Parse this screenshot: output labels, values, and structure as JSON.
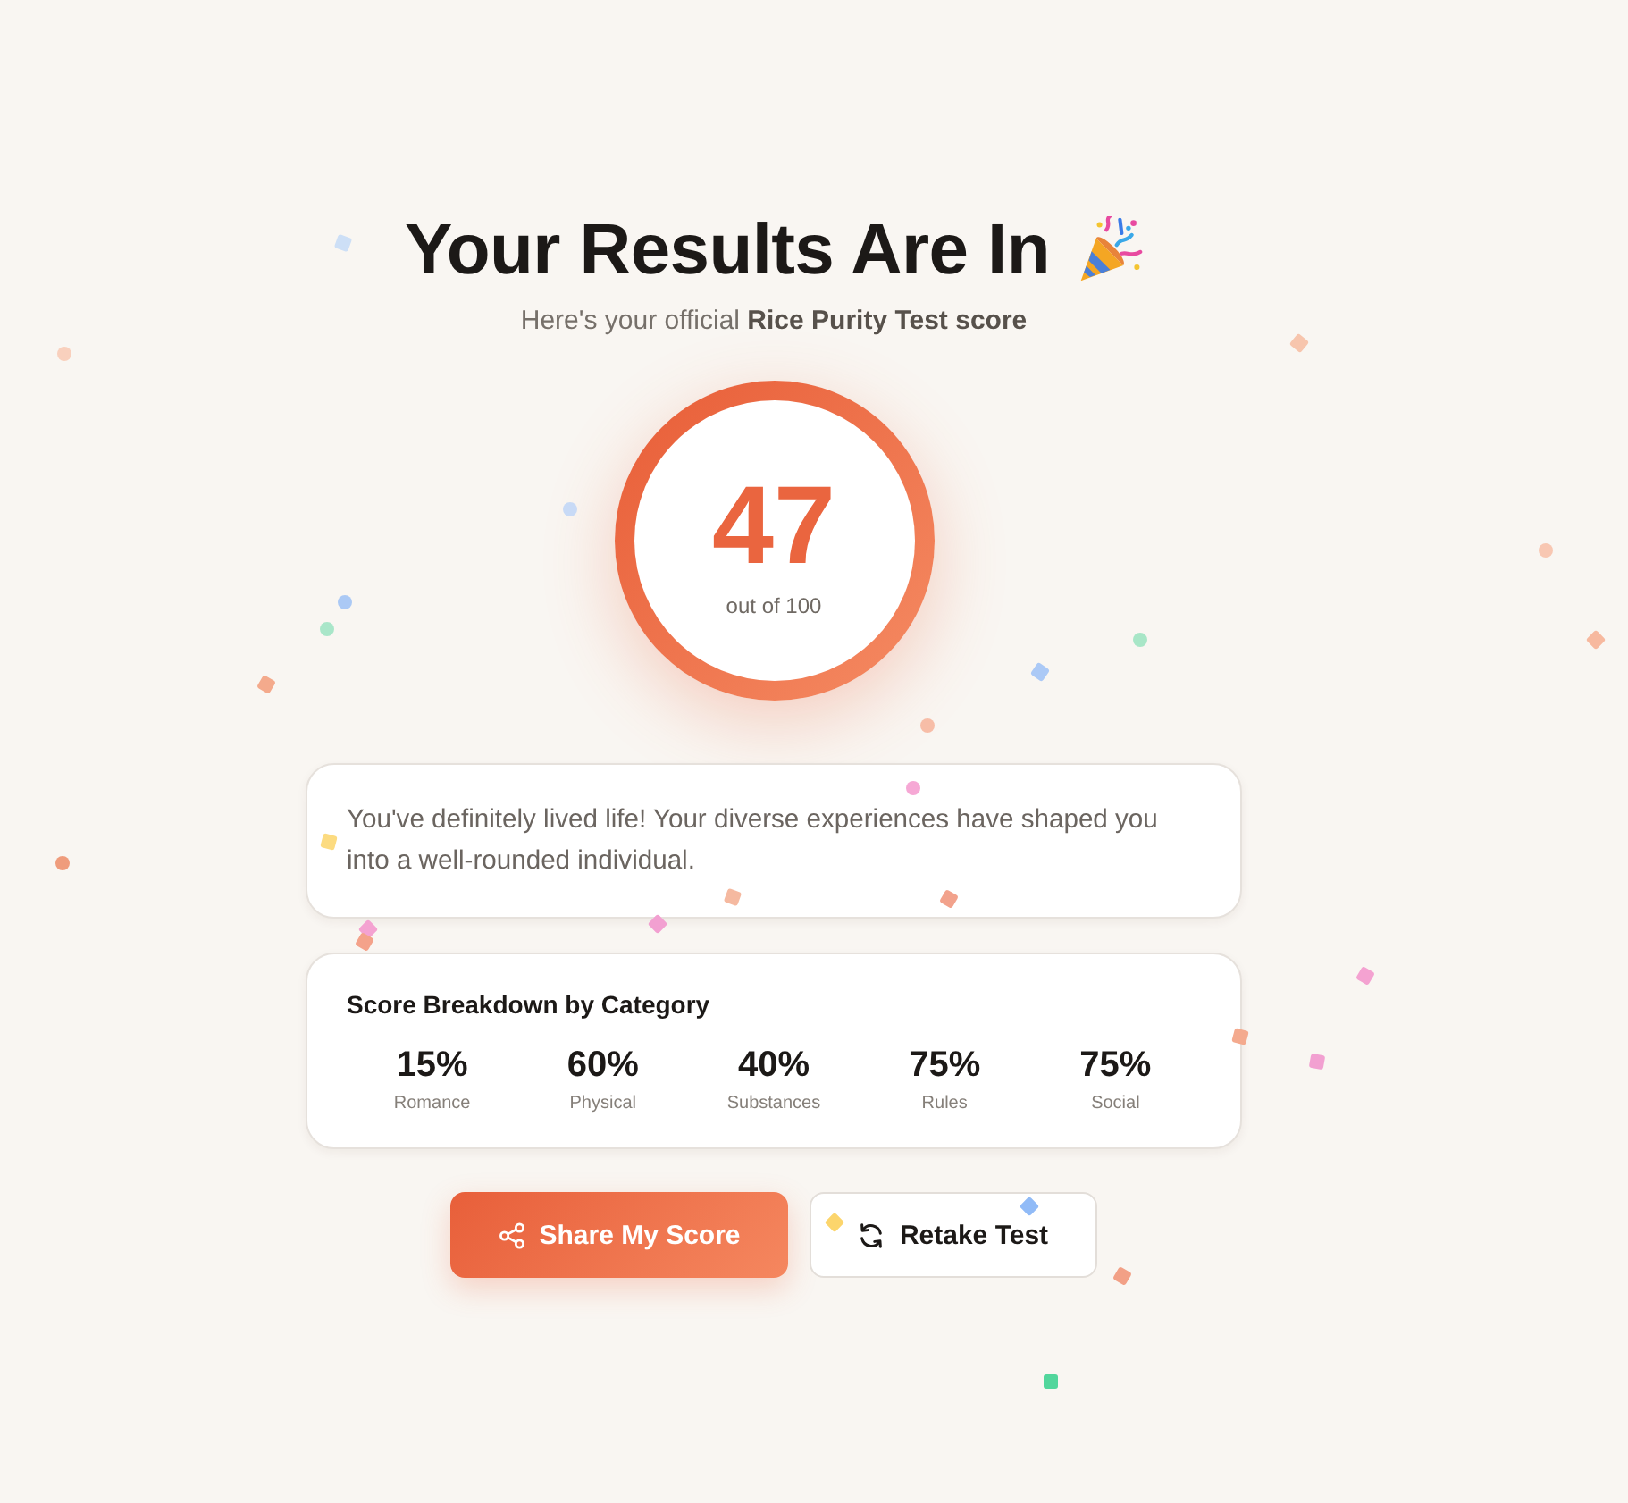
{
  "header": {
    "title": "Your Results Are In",
    "subtitle": "Here's your official **Rice Purity Test score**"
  },
  "score": {
    "value": "47",
    "caption": "out of 100"
  },
  "message": "You've definitely lived life! Your diverse experiences have shaped you into a well-rounded individual.",
  "breakdown": {
    "title": "Score Breakdown by Category",
    "categories": [
      {
        "value": "15%",
        "label": "Romance"
      },
      {
        "value": "60%",
        "label": "Physical"
      },
      {
        "value": "40%",
        "label": "Substances"
      },
      {
        "value": "75%",
        "label": "Rules"
      },
      {
        "value": "75%",
        "label": "Social"
      }
    ]
  },
  "actions": [
    {
      "kind": "primary",
      "label": "Share My Score"
    },
    {
      "kind": "secondary",
      "label": "Retake Test"
    }
  ]
}
